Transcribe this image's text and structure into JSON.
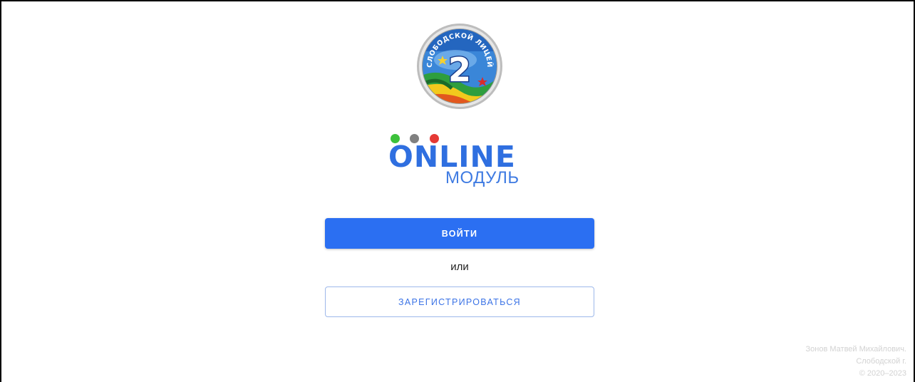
{
  "logo": {
    "arc_text": "СЛОБОДСКОЙ ЛИЦЕЙ",
    "emblem_number": "2"
  },
  "brand": {
    "title": "ONLINE",
    "subtitle": "МОДУЛЬ",
    "dot_colors": [
      "#3cc13b",
      "#808080",
      "#e53935"
    ]
  },
  "auth": {
    "login_label": "ВОЙТИ",
    "or_label": "или",
    "register_label": "ЗАРЕГИСТРИРОВАТЬСЯ"
  },
  "footer": {
    "author": "Зонов Матвей Михайлович.",
    "city": "Слободской г.",
    "copyright": "© 2020–2023"
  },
  "colors": {
    "primary": "#2b6ff2",
    "brand_blue": "#2f6fe0",
    "outline_border": "#9db8ea",
    "footer_text": "#d2d2d2"
  }
}
